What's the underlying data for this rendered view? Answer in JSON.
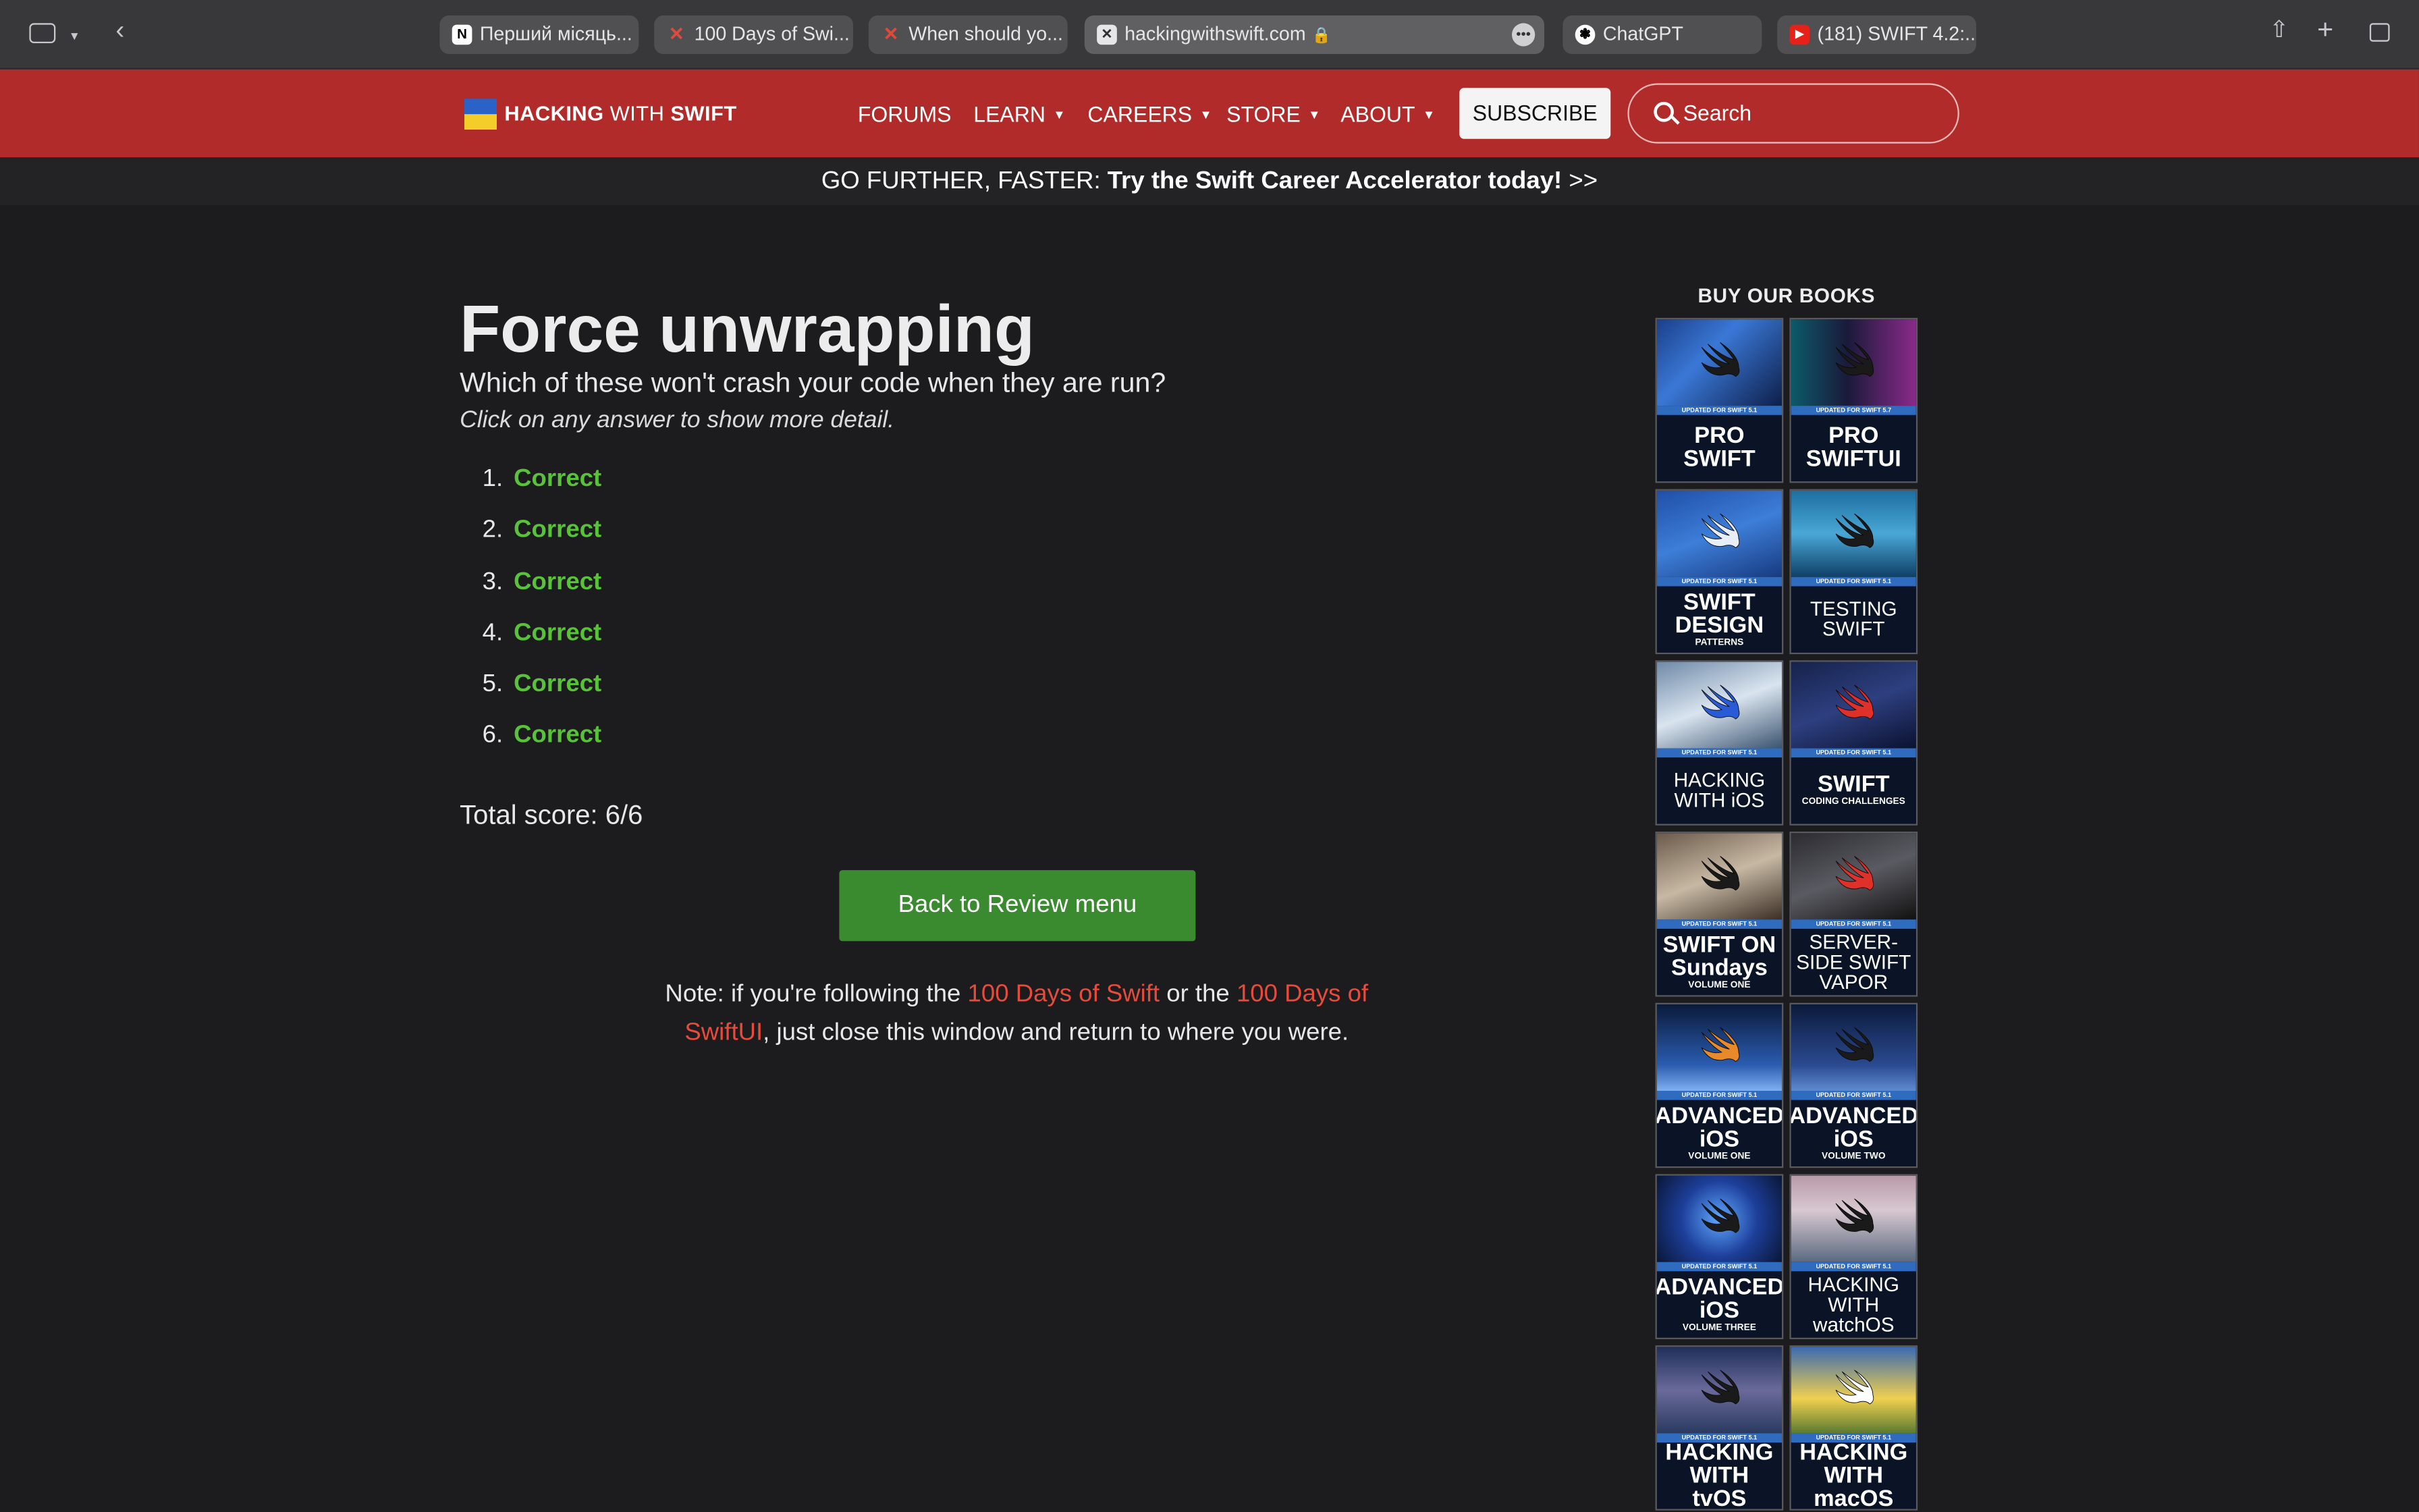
{
  "browser": {
    "tabs": [
      {
        "title": "Перший місяць...",
        "icon": "notion-icon"
      },
      {
        "title": "100 Days of Swi...",
        "icon": "swift-icon"
      },
      {
        "title": "When should yo...",
        "icon": "swift-icon"
      },
      {
        "title": "hackingwithswift.com",
        "icon": "close-icon",
        "active": true
      },
      {
        "title": "ChatGPT",
        "icon": "chatgpt-icon"
      },
      {
        "title": "(181) SWIFT 4.2:...",
        "icon": "youtube-icon"
      }
    ],
    "more_label": "•••"
  },
  "site": {
    "logo_bold1": "HACKING",
    "logo_thin": " WITH ",
    "logo_bold2": "SWIFT",
    "nav": [
      "FORUMS",
      "LEARN",
      "CAREERS",
      "STORE",
      "ABOUT"
    ],
    "subscribe": "SUBSCRIBE",
    "search_placeholder": "Search",
    "promo_lead": "GO FURTHER, FASTER: ",
    "promo_bold": "Try the Swift Career Accelerator today!",
    "promo_tail": " >>"
  },
  "quiz": {
    "title": "Force unwrapping",
    "question": "Which of these won't crash your code when they are run?",
    "hint": "Click on any answer to show more detail.",
    "answers": [
      {
        "num": "1.",
        "result": "Correct"
      },
      {
        "num": "2.",
        "result": "Correct"
      },
      {
        "num": "3.",
        "result": "Correct"
      },
      {
        "num": "4.",
        "result": "Correct"
      },
      {
        "num": "5.",
        "result": "Correct"
      },
      {
        "num": "6.",
        "result": "Correct"
      }
    ],
    "score": "Total score: 6/6",
    "back_button": "Back to Review menu",
    "note_a": "Note: if you're following the ",
    "note_link1": "100 Days of Swift",
    "note_b": " or the ",
    "note_link2": "100 Days of SwiftUI",
    "note_c": ", just close this window and return to where you were."
  },
  "books": {
    "title": "BUY OUR BOOKS",
    "items": [
      {
        "band": "UPDATED FOR SWIFT 5.1",
        "line1": "PRO",
        "line2": "SWIFT",
        "sub": ""
      },
      {
        "band": "UPDATED FOR SWIFT 5.7",
        "line1": "PRO",
        "line2": "SWIFTUI",
        "sub": ""
      },
      {
        "band": "UPDATED FOR SWIFT 5.1",
        "line1": "SWIFT",
        "line2": "DESIGN",
        "sub": "PATTERNS"
      },
      {
        "band": "UPDATED FOR SWIFT 5.1",
        "line1": "TESTING",
        "line2": "SWIFT",
        "sub": ""
      },
      {
        "band": "UPDATED FOR SWIFT 5.1",
        "line1": "HACKING",
        "line2": "WITH iOS",
        "sub": ""
      },
      {
        "band": "UPDATED FOR SWIFT 5.1",
        "line1": "SWIFT",
        "line2": "",
        "sub": "CODING CHALLENGES"
      },
      {
        "band": "UPDATED FOR SWIFT 5.1",
        "line1": "SWIFT ON",
        "line2": "Sundays",
        "sub": "VOLUME ONE"
      },
      {
        "band": "UPDATED FOR SWIFT 5.1",
        "line1": "SERVER-SIDE SWIFT",
        "line2": "VAPOR",
        "sub": ""
      },
      {
        "band": "UPDATED FOR SWIFT 5.1",
        "line1": "ADVANCED",
        "line2": "iOS",
        "sub": "VOLUME ONE"
      },
      {
        "band": "UPDATED FOR SWIFT 5.1",
        "line1": "ADVANCED",
        "line2": "iOS",
        "sub": "VOLUME TWO"
      },
      {
        "band": "UPDATED FOR SWIFT 5.1",
        "line1": "ADVANCED",
        "line2": "iOS",
        "sub": "VOLUME THREE"
      },
      {
        "band": "UPDATED FOR SWIFT 5.1",
        "line1": "HACKING WITH",
        "line2": "watchOS",
        "sub": ""
      },
      {
        "band": "UPDATED FOR SWIFT 5.1",
        "line1": "HACKING WITH",
        "line2": "tvOS",
        "sub": ""
      },
      {
        "band": "UPDATED FOR SWIFT 5.1",
        "line1": "HACKING WITH",
        "line2": "macOS",
        "sub": ""
      }
    ]
  },
  "colors": {
    "header_red": "#b02b2a",
    "correct_green": "#58c339",
    "button_green": "#3a8b2f",
    "link_red": "#e64b3c",
    "background": "#1c1c1e"
  }
}
